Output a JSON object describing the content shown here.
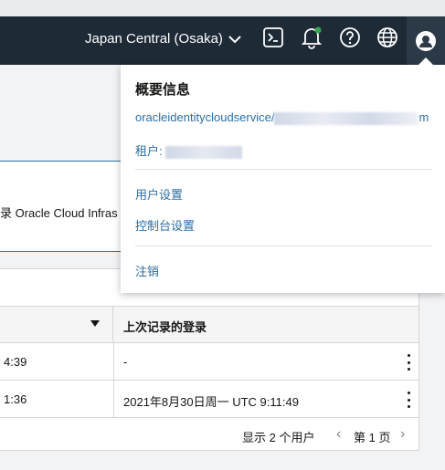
{
  "topbar": {
    "region": "Japan Central (Osaka)",
    "icons": [
      "cloud-shell-icon",
      "bell-icon",
      "help-icon",
      "globe-icon",
      "user-icon"
    ],
    "accent": "#34a853"
  },
  "background": {
    "field_text": "录 Oracle Cloud Infras",
    "table": {
      "header_col2": "上次记录的登录",
      "rows": [
        {
          "c1": "4:39",
          "c2": "-"
        },
        {
          "c1": "1:36",
          "c2": "2021年8月30日周一 UTC 9:11:49"
        }
      ],
      "footer": {
        "count": "显示 2 个用户",
        "page": "第 1 页"
      }
    }
  },
  "dropdown": {
    "title": "概要信息",
    "email_prefix": "oracleidentitycloudservice/",
    "email_suffix": "m",
    "tenant_label": "租户:",
    "links": [
      "用户设置",
      "控制台设置",
      "注销"
    ]
  }
}
